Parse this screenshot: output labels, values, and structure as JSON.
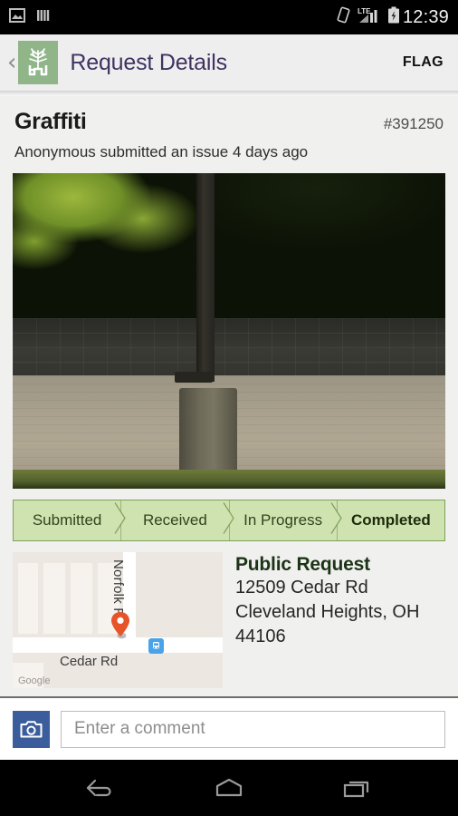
{
  "status_bar": {
    "icons": [
      "image-icon",
      "barcode-icon"
    ],
    "network_label": "LTE",
    "right_icons": [
      "rotation-lock-icon",
      "signal-icon",
      "battery-charging-icon"
    ],
    "clock": "12:39"
  },
  "header": {
    "back_label": "‹",
    "logo_name": "cleveland-heights-tree-logo",
    "title": "Request Details",
    "flag_label": "FLAG"
  },
  "request": {
    "title": "Graffiti",
    "id": "#391250",
    "subtitle": "Anonymous submitted an issue 4 days ago",
    "photo_alt": "utility-pole-concrete-base-photo"
  },
  "steps": [
    {
      "label": "Submitted",
      "active": false
    },
    {
      "label": "Received",
      "active": false
    },
    {
      "label": "In Progress",
      "active": false
    },
    {
      "label": "Completed",
      "active": true
    }
  ],
  "map": {
    "street_horizontal": "Cedar Rd",
    "street_vertical": "Norfolk Rd",
    "pin_name": "location-pin",
    "transit_name": "bus-stop-icon",
    "attribution": "Google"
  },
  "address": {
    "heading": "Public Request",
    "line1": "12509 Cedar Rd",
    "line2": "Cleveland Heights, OH",
    "line3": "44106"
  },
  "comment": {
    "camera_name": "camera-button",
    "placeholder": "Enter a comment",
    "value": ""
  },
  "nav": {
    "back": "back-button",
    "home": "home-button",
    "recents": "recents-button"
  },
  "colors": {
    "brand_green": "#8fb589",
    "step_fill": "#cfe3b0",
    "step_border": "#7f9e5c",
    "title_purple": "#3f3361",
    "pin_orange": "#e8542a",
    "camera_blue": "#3b5d9b",
    "transit_blue": "#4aa3e8"
  }
}
